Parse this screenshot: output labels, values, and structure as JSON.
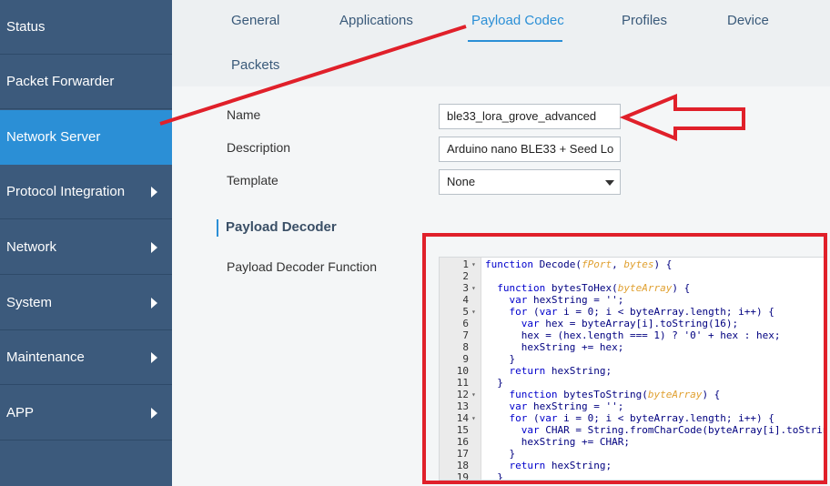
{
  "sidebar": {
    "items": [
      {
        "label": "Status",
        "has_arrow": false,
        "active": false
      },
      {
        "label": "Packet Forwarder",
        "has_arrow": false,
        "active": false
      },
      {
        "label": "Network Server",
        "has_arrow": false,
        "active": true
      },
      {
        "label": "Protocol Integration",
        "has_arrow": true,
        "active": false
      },
      {
        "label": "Network",
        "has_arrow": true,
        "active": false
      },
      {
        "label": "System",
        "has_arrow": true,
        "active": false
      },
      {
        "label": "Maintenance",
        "has_arrow": true,
        "active": false
      },
      {
        "label": "APP",
        "has_arrow": true,
        "active": false
      }
    ]
  },
  "tabs": [
    {
      "label": "General",
      "active": false
    },
    {
      "label": "Applications",
      "active": false
    },
    {
      "label": "Payload Codec",
      "active": true
    },
    {
      "label": "Profiles",
      "active": false
    },
    {
      "label": "Device",
      "active": false
    },
    {
      "label": "Packets",
      "active": false
    }
  ],
  "form": {
    "name_label": "Name",
    "name_value": "ble33_lora_grove_advanced",
    "description_label": "Description",
    "description_value": "Arduino nano BLE33 + Seed Lo",
    "template_label": "Template",
    "template_value": "None",
    "section_title": "Payload Decoder",
    "decoder_function_label": "Payload Decoder Function"
  },
  "editor": {
    "lines": [
      {
        "n": "1",
        "fold": true,
        "code": "function Decode(fPort, bytes) {"
      },
      {
        "n": "2",
        "fold": false,
        "code": ""
      },
      {
        "n": "3",
        "fold": true,
        "code": "  function bytesToHex(byteArray) {"
      },
      {
        "n": "4",
        "fold": false,
        "code": "    var hexString = '';"
      },
      {
        "n": "5",
        "fold": true,
        "code": "    for (var i = 0; i < byteArray.length; i++) {"
      },
      {
        "n": "6",
        "fold": false,
        "code": "      var hex = byteArray[i].toString(16);"
      },
      {
        "n": "7",
        "fold": false,
        "code": "      hex = (hex.length === 1) ? '0' + hex : hex;"
      },
      {
        "n": "8",
        "fold": false,
        "code": "      hexString += hex;"
      },
      {
        "n": "9",
        "fold": false,
        "code": "    }"
      },
      {
        "n": "10",
        "fold": false,
        "code": "    return hexString;"
      },
      {
        "n": "11",
        "fold": false,
        "code": "  }"
      },
      {
        "n": "12",
        "fold": true,
        "code": "    function bytesToString(byteArray) {"
      },
      {
        "n": "13",
        "fold": false,
        "code": "    var hexString = '';"
      },
      {
        "n": "14",
        "fold": true,
        "code": "    for (var i = 0; i < byteArray.length; i++) {"
      },
      {
        "n": "15",
        "fold": false,
        "code": "      var CHAR = String.fromCharCode(byteArray[i].toString());"
      },
      {
        "n": "16",
        "fold": false,
        "code": "      hexString += CHAR;"
      },
      {
        "n": "17",
        "fold": false,
        "code": "    }"
      },
      {
        "n": "18",
        "fold": false,
        "code": "    return hexString;"
      },
      {
        "n": "19",
        "fold": false,
        "code": "  }"
      }
    ]
  },
  "colors": {
    "sidebar_bg": "#3c5a7c",
    "sidebar_active": "#2b8fd6",
    "accent": "#2b8fd6",
    "annotation_red": "#e0202a"
  }
}
